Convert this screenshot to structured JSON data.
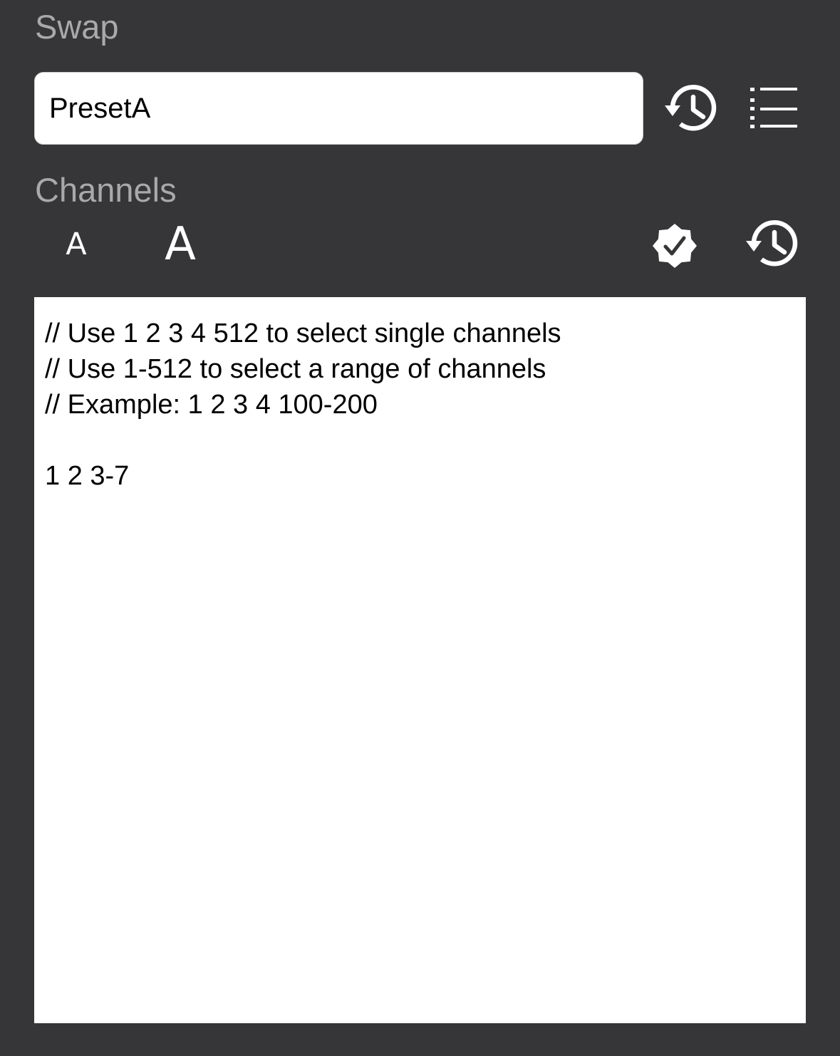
{
  "swap": {
    "label": "Swap",
    "preset_value": "PresetA"
  },
  "swap_toolbar": {
    "history_icon": "history-icon",
    "list_icon": "list-icon"
  },
  "channels": {
    "label": "Channels",
    "font_smaller_label": "A",
    "font_larger_label": "A",
    "verify_icon": "verified-badge-icon",
    "history_icon": "history-icon",
    "editor_text": "// Use 1 2 3 4 512 to select single channels\n// Use 1-512 to select a range of channels\n// Example: 1 2 3 4 100-200\n\n1 2 3-7"
  },
  "colors": {
    "background": "#363537",
    "label": "#a9a9ab",
    "icon": "#ffffff",
    "field": "#ffffff"
  }
}
